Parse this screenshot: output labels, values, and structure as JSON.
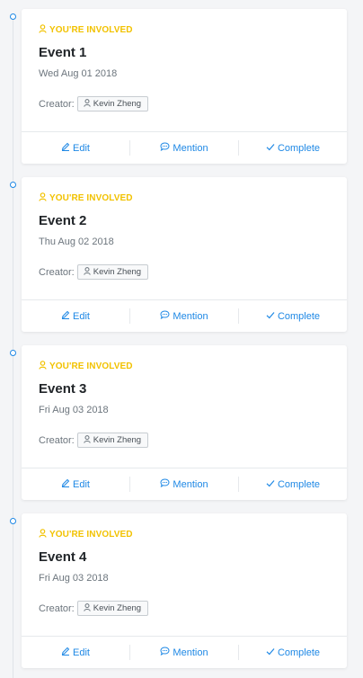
{
  "involved_label": "YOU'RE INVOLVED",
  "creator_label": "Creator:",
  "actions": {
    "edit": "Edit",
    "mention": "Mention",
    "complete": "Complete"
  },
  "colors": {
    "accent": "#1e88e5",
    "involved": "#f2c200"
  },
  "icons": {
    "involved": "user-icon",
    "creator": "user-icon",
    "edit": "pencil-icon",
    "mention": "comment-icon",
    "complete": "check-icon",
    "timeline_dot": "circle-icon"
  },
  "events": [
    {
      "title": "Event 1",
      "date": "Wed Aug 01 2018",
      "creator": "Kevin Zheng"
    },
    {
      "title": "Event 2",
      "date": "Thu Aug 02 2018",
      "creator": "Kevin Zheng"
    },
    {
      "title": "Event 3",
      "date": "Fri Aug 03 2018",
      "creator": "Kevin Zheng"
    },
    {
      "title": "Event 4",
      "date": "Fri Aug 03 2018",
      "creator": "Kevin Zheng"
    }
  ]
}
